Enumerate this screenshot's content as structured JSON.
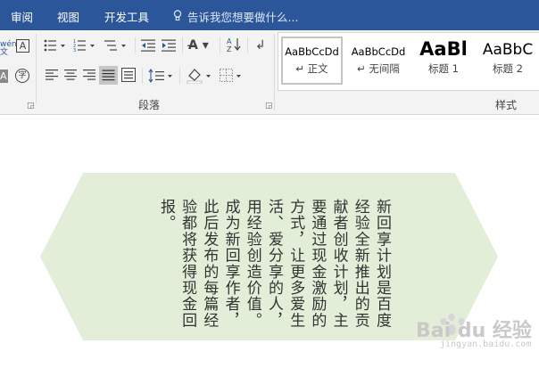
{
  "tabs": [
    "审阅",
    "视图",
    "开发工具"
  ],
  "tell_me": "告诉我您想要做什么...",
  "ribbon": {
    "paragraph_label": "段落",
    "styles_label": "样式",
    "styles": [
      {
        "preview": "AaBbCcDd",
        "name": "↵ 正文"
      },
      {
        "preview": "AaBbCcDd",
        "name": "↵ 无间隔"
      },
      {
        "preview": "AaBl",
        "name": "标题 1"
      },
      {
        "preview": "AaBbC",
        "name": "标题 2"
      }
    ]
  },
  "icons": {
    "bullets": "bullet-list-icon",
    "numbering": "numbered-list-icon",
    "multilevel": "multilevel-list-icon",
    "decrease_indent": "decrease-indent-icon",
    "increase_indent": "increase-indent-icon",
    "chinese_layout": "chinese-layout-icon",
    "sort": "sort-icon",
    "show_marks": "paragraph-mark-icon",
    "align_left": "align-left-icon",
    "align_center": "align-center-icon",
    "align_right": "align-right-icon",
    "justify": "justify-icon",
    "distributed": "distributed-icon",
    "line_spacing": "line-spacing-icon",
    "shading": "shading-icon",
    "borders": "borders-icon"
  },
  "document": {
    "text": "新回享计划是百度经验全新推出的贡献者创收计划，主要通过现金激励的方式，让更多爱生活、爱分享的人，用经验创造价值。成为新回享作者，此后发布的每篇经验都将获得现金回报。",
    "shape_fill": "#e2eed8"
  },
  "watermark": {
    "text": "Bai du 经验",
    "sub": "jingyan.baidu.com"
  },
  "colors": {
    "title_bar": "#2b579a",
    "ribbon_bg": "#f3f3f3"
  }
}
